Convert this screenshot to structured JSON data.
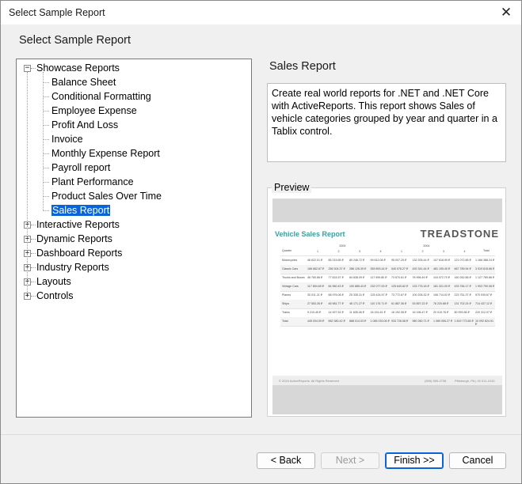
{
  "window": {
    "title": "Select Sample Report",
    "close_glyph": "✕",
    "close_icon": "close-icon"
  },
  "heading": "Select Sample Report",
  "tree": {
    "items": [
      {
        "label": "Showcase Reports",
        "expanded": true,
        "children": [
          "Balance Sheet",
          "Conditional Formatting",
          "Employee Expense",
          "Profit And Loss",
          "Invoice",
          "Monthly Expense Report",
          "Payroll report",
          "Plant Performance",
          "Product Sales Over Time",
          "Sales Report"
        ]
      },
      {
        "label": "Interactive Reports",
        "expanded": false
      },
      {
        "label": "Dynamic Reports",
        "expanded": false
      },
      {
        "label": "Dashboard Reports",
        "expanded": false
      },
      {
        "label": "Industry Reports",
        "expanded": false
      },
      {
        "label": "Layouts",
        "expanded": false
      },
      {
        "label": "Controls",
        "expanded": false
      }
    ],
    "selected": "Sales Report",
    "expanded_glyph": "−",
    "collapsed_glyph": "+"
  },
  "details": {
    "title": "Sales Report",
    "description": "Create real world reports for .NET and .NET Core with ActiveReports. This report shows Sales of vehicle categories grouped by year and quarter in a Tablix control.",
    "preview_label": "Preview"
  },
  "preview": {
    "report_title": "Vehicle Sales Report",
    "logo_text": "TREADSTONE",
    "accent_color": "#3aa0a0",
    "years": [
      "2003",
      "2004"
    ],
    "quarters": [
      "1",
      "2",
      "3",
      "4",
      "1",
      "2",
      "3",
      "4"
    ],
    "col_total": "Total",
    "row_header": "Quarter",
    "rows": [
      {
        "label": "Motorcycles",
        "values": [
          "46 622.01 ₽",
          "85 215.65 ₽",
          "80 246.72 ₽",
          "99 612.08 ₽",
          "95 007.25 ₽",
          "132 205.44 ₽",
          "107 818.90 ₽",
          "121 072.85 ₽"
        ],
        "total": "1 166 388.24 ₽"
      },
      {
        "label": "Classic Cars",
        "values": [
          "166 662.87 ₽",
          "256 304.37 ₽",
          "286 126.39 ₽",
          "359 893.44 ₽",
          "540 076.27 ₽",
          "492 341.44 ₽",
          "481 195.40 ₽",
          "667 789.94 ₽"
        ],
        "total": "3 919 615.66 ₽"
      },
      {
        "label": "Trucks and Buses",
        "values": [
          "46 760.66 ₽",
          "77 624.57 ₽",
          "84 838.09 ₽",
          "117 999.80 ₽",
          "73 670.61 ₽",
          "78 996.49 ₽",
          "116 472.70 ₽",
          "160 262.86 ₽"
        ],
        "total": "1 127 789.66 ₽"
      },
      {
        "label": "Vintage Cars",
        "values": [
          "117 894.69 ₽",
          "84 960.43 ₽",
          "100 885.43 ₽",
          "232 077.00 ₽",
          "125 640.62 ₽",
          "133 776.18 ₽",
          "181 321.00 ₽",
          "433 784.17 ₽"
        ],
        "total": "1 903 790.08 ₽"
      },
      {
        "label": "Planes",
        "values": [
          "30 011.21 ₽",
          "68 976.08 ₽",
          "25 335.31 ₽",
          "125 424.57 ₽",
          "73 772.67 ₽",
          "100 205.32 ₽",
          "106 714.02 ₽",
          "223 751.37 ₽"
        ],
        "total": "970 039.67 ₽"
      },
      {
        "label": "Ships",
        "values": [
          "27 553.26 ₽",
          "46 981.77 ₽",
          "46 171.27 ₽",
          "110 175.71 ₽",
          "61 887.36 ₽",
          "53 857.22 ₽",
          "76 220.88 ₽",
          "131 702.24 ₽"
        ],
        "total": "714 437.12 ₽"
      },
      {
        "label": "Trains",
        "values": [
          "9 210.45 ₽",
          "14 927.52 ₽",
          "11 835.06 ₽",
          "18 151.61 ₽",
          "16 192.06 ₽",
          "16 196.47 ₽",
          "20 010.76 ₽",
          "80 993.58 ₽"
        ],
        "total": "220 312.07 ₽"
      },
      {
        "label": "Total",
        "values": [
          "445 004.09 ₽",
          "652 380.42 ₽",
          "688 014.03 ₽",
          "1 065 033.06 ₽",
          "933 726.58 ₽",
          "980 260.71 ₽",
          "1 089 055.27 ₽",
          "1 819 773.65 ₽"
        ],
        "total": "10 092 624.91 ₽"
      }
    ],
    "footer_left": "© 2024 ActiveReports. All Rights Reserved",
    "footer_phone": "(555) 555-2738",
    "footer_address": "Pittsburgh, PA | 15 011-1010"
  },
  "buttons": {
    "back": "< Back",
    "next": "Next >",
    "finish": "Finish >>",
    "cancel": "Cancel"
  }
}
